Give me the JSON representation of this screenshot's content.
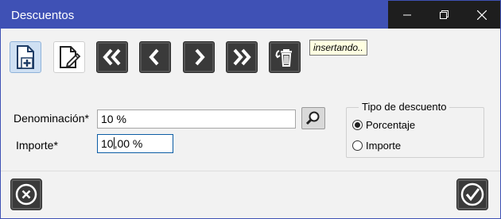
{
  "window": {
    "title": "Descuentos"
  },
  "toolbar": {
    "tooltip": "insertando..",
    "buttons": [
      {
        "name": "new-record",
        "icon": "new-document-icon"
      },
      {
        "name": "edit-record",
        "icon": "edit-document-icon"
      },
      {
        "name": "first-record",
        "icon": "double-chevron-left-icon"
      },
      {
        "name": "previous-record",
        "icon": "chevron-left-icon"
      },
      {
        "name": "next-record",
        "icon": "chevron-right-icon"
      },
      {
        "name": "last-record",
        "icon": "double-chevron-right-icon"
      },
      {
        "name": "delete-record",
        "icon": "undo-trash-icon"
      }
    ]
  },
  "form": {
    "denominacion": {
      "label": "Denominación*",
      "value": "10 %"
    },
    "importe": {
      "label": "Importe*",
      "value_before_caret": "10",
      "value_after_caret": ",00 %"
    }
  },
  "tipo_descuento": {
    "title": "Tipo de descuento",
    "options": [
      {
        "label": "Porcentaje",
        "checked": true
      },
      {
        "label": "Importe",
        "checked": false
      }
    ]
  },
  "footer": {
    "cancel_icon": "close-circle-icon",
    "confirm_icon": "check-circle-icon"
  },
  "colors": {
    "titlebar": "#3f51b5",
    "button_dark": "#3a3a3a"
  }
}
